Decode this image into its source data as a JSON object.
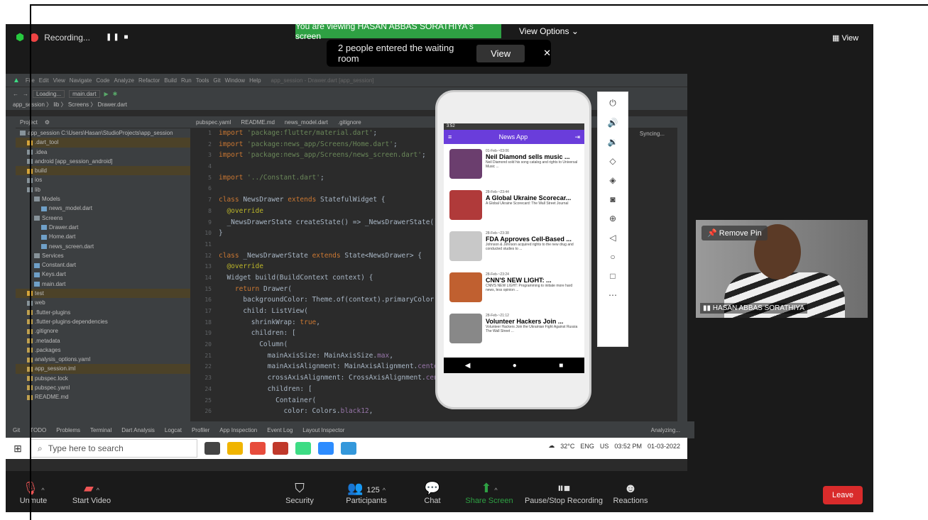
{
  "zoom": {
    "recording_label": "Recording...",
    "viewing_banner": "You are viewing HASAN ABBAS SORATHIYA's screen",
    "view_options_label": "View Options ⌄",
    "waiting_room_text": "2 people entered the waiting room",
    "waiting_view_button": "View",
    "waiting_close": "✕",
    "view_button": "View"
  },
  "ide": {
    "menu": [
      "File",
      "Edit",
      "View",
      "Navigate",
      "Code",
      "Analyze",
      "Refactor",
      "Build",
      "Run",
      "Tools",
      "Git",
      "Window",
      "Help"
    ],
    "title_path": "app_session - Drawer.dart [app_session]",
    "toolbar_device": "Loading...",
    "toolbar_config": "main.dart",
    "breadcrumb": "app_session 〉 lib 〉 Screens 〉 Drawer.dart",
    "project_label": "Project",
    "tree": [
      {
        "label": "app_session  C:\\Users\\Hasan\\StudioProjects\\app_session",
        "kind": "folder",
        "hl": false
      },
      {
        "label": ".dart_tool",
        "kind": "folder-y",
        "hl": true
      },
      {
        "label": ".idea",
        "kind": "folder",
        "hl": false
      },
      {
        "label": "android [app_session_android]",
        "kind": "folder",
        "hl": false
      },
      {
        "label": "build",
        "kind": "folder-y",
        "hl": true
      },
      {
        "label": "ios",
        "kind": "folder",
        "hl": false
      },
      {
        "label": "lib",
        "kind": "folder",
        "hl": false
      },
      {
        "label": "Models",
        "kind": "folder",
        "hl": false
      },
      {
        "label": "news_model.dart",
        "kind": "file-d",
        "hl": false
      },
      {
        "label": "Screens",
        "kind": "folder",
        "hl": false
      },
      {
        "label": "Drawer.dart",
        "kind": "file-d",
        "hl": false
      },
      {
        "label": "Home.dart",
        "kind": "file-d",
        "hl": false
      },
      {
        "label": "news_screen.dart",
        "kind": "file-d",
        "hl": false
      },
      {
        "label": "Services",
        "kind": "folder",
        "hl": false
      },
      {
        "label": "Constant.dart",
        "kind": "file-d",
        "hl": false
      },
      {
        "label": "Keys.dart",
        "kind": "file-d",
        "hl": false
      },
      {
        "label": "main.dart",
        "kind": "file-d",
        "hl": false
      },
      {
        "label": "test",
        "kind": "folder-y",
        "hl": true
      },
      {
        "label": "web",
        "kind": "folder",
        "hl": false
      },
      {
        "label": ".flutter-plugins",
        "kind": "file-y",
        "hl": false
      },
      {
        "label": ".flutter-plugins-dependencies",
        "kind": "file-y",
        "hl": false
      },
      {
        "label": ".gitignore",
        "kind": "file-y",
        "hl": false
      },
      {
        "label": ".metadata",
        "kind": "file-y",
        "hl": false
      },
      {
        "label": ".packages",
        "kind": "file-y",
        "hl": false
      },
      {
        "label": "analysis_options.yaml",
        "kind": "file-y",
        "hl": false
      },
      {
        "label": "app_session.iml",
        "kind": "file-y",
        "hl": true
      },
      {
        "label": "pubspec.lock",
        "kind": "file-y",
        "hl": false
      },
      {
        "label": "pubspec.yaml",
        "kind": "file-y",
        "hl": false
      },
      {
        "label": "README.md",
        "kind": "file-y",
        "hl": false
      }
    ],
    "tabs": [
      "pubspec.yaml",
      "README.md",
      "news_model.dart",
      ".gitignore"
    ],
    "line_numbers": [
      "1",
      "2",
      "3",
      "4",
      "5",
      "6",
      "7",
      "8",
      "9",
      "10",
      "11",
      "12",
      "13",
      "14",
      "15",
      "16",
      "17",
      "18",
      "19",
      "20",
      "21",
      "22",
      "23",
      "24",
      "25",
      "26"
    ],
    "syncing": "Syncing...",
    "bottom_tabs": [
      "Git",
      "TODO",
      "Problems",
      "Terminal",
      "Dart Analysis",
      "Logcat",
      "Profiler",
      "App Inspection",
      "Event Log",
      "Layout Inspector"
    ],
    "analyzing": "Analyzing..."
  },
  "taskbar": {
    "search_placeholder": "Type here to search",
    "temperature": "32°C",
    "language": "ENG",
    "region": "US",
    "time": "03:52 PM",
    "date": "01-03-2022"
  },
  "emulator": {
    "status_time": "3:52",
    "app_title": "News App",
    "news": [
      {
        "date": "01-Feb-~03:06",
        "title": "Neil Diamond sells music ...",
        "desc": "Neil Diamond sold his song catalog and rights to Universal Music ...",
        "color": "#6b3e6e"
      },
      {
        "date": "28-Feb-~23:44",
        "title": "A Global Ukraine Scorecar...",
        "desc": "A Global Ukraine Scorecard: The Wall Street Journal",
        "color": "#b03a3a"
      },
      {
        "date": "28-Feb-~23:38",
        "title": "FDA Approves Cell-Based ...",
        "desc": "Johnson & Johnson acquired rights to the new drug and conducted studies to ...",
        "color": "#c8c8c8"
      },
      {
        "date": "28-Feb-~23:24",
        "title": "CNN'S NEW LIGHT: ...",
        "desc": "CNN'S NEW LIGHT: Programming to initiate more hard news, less opinion ...",
        "color": "#c06030"
      },
      {
        "date": "28-Feb-~21:12",
        "title": "Volunteer Hackers Join ...",
        "desc": "Volunteer Hackers Join the Ukrainian Fight Against Russia  The Wall Street ...",
        "color": "#888888"
      }
    ]
  },
  "participant": {
    "remove_pin": "Remove Pin",
    "name": "HASAN ABBAS SORATHIYA"
  },
  "toolbar": {
    "unmute": "Unmute",
    "start_video": "Start Video",
    "security": "Security",
    "participants": "Participants",
    "participants_count": "125",
    "chat": "Chat",
    "share_screen": "Share Screen",
    "pause_recording": "Pause/Stop Recording",
    "reactions": "Reactions",
    "leave": "Leave"
  }
}
